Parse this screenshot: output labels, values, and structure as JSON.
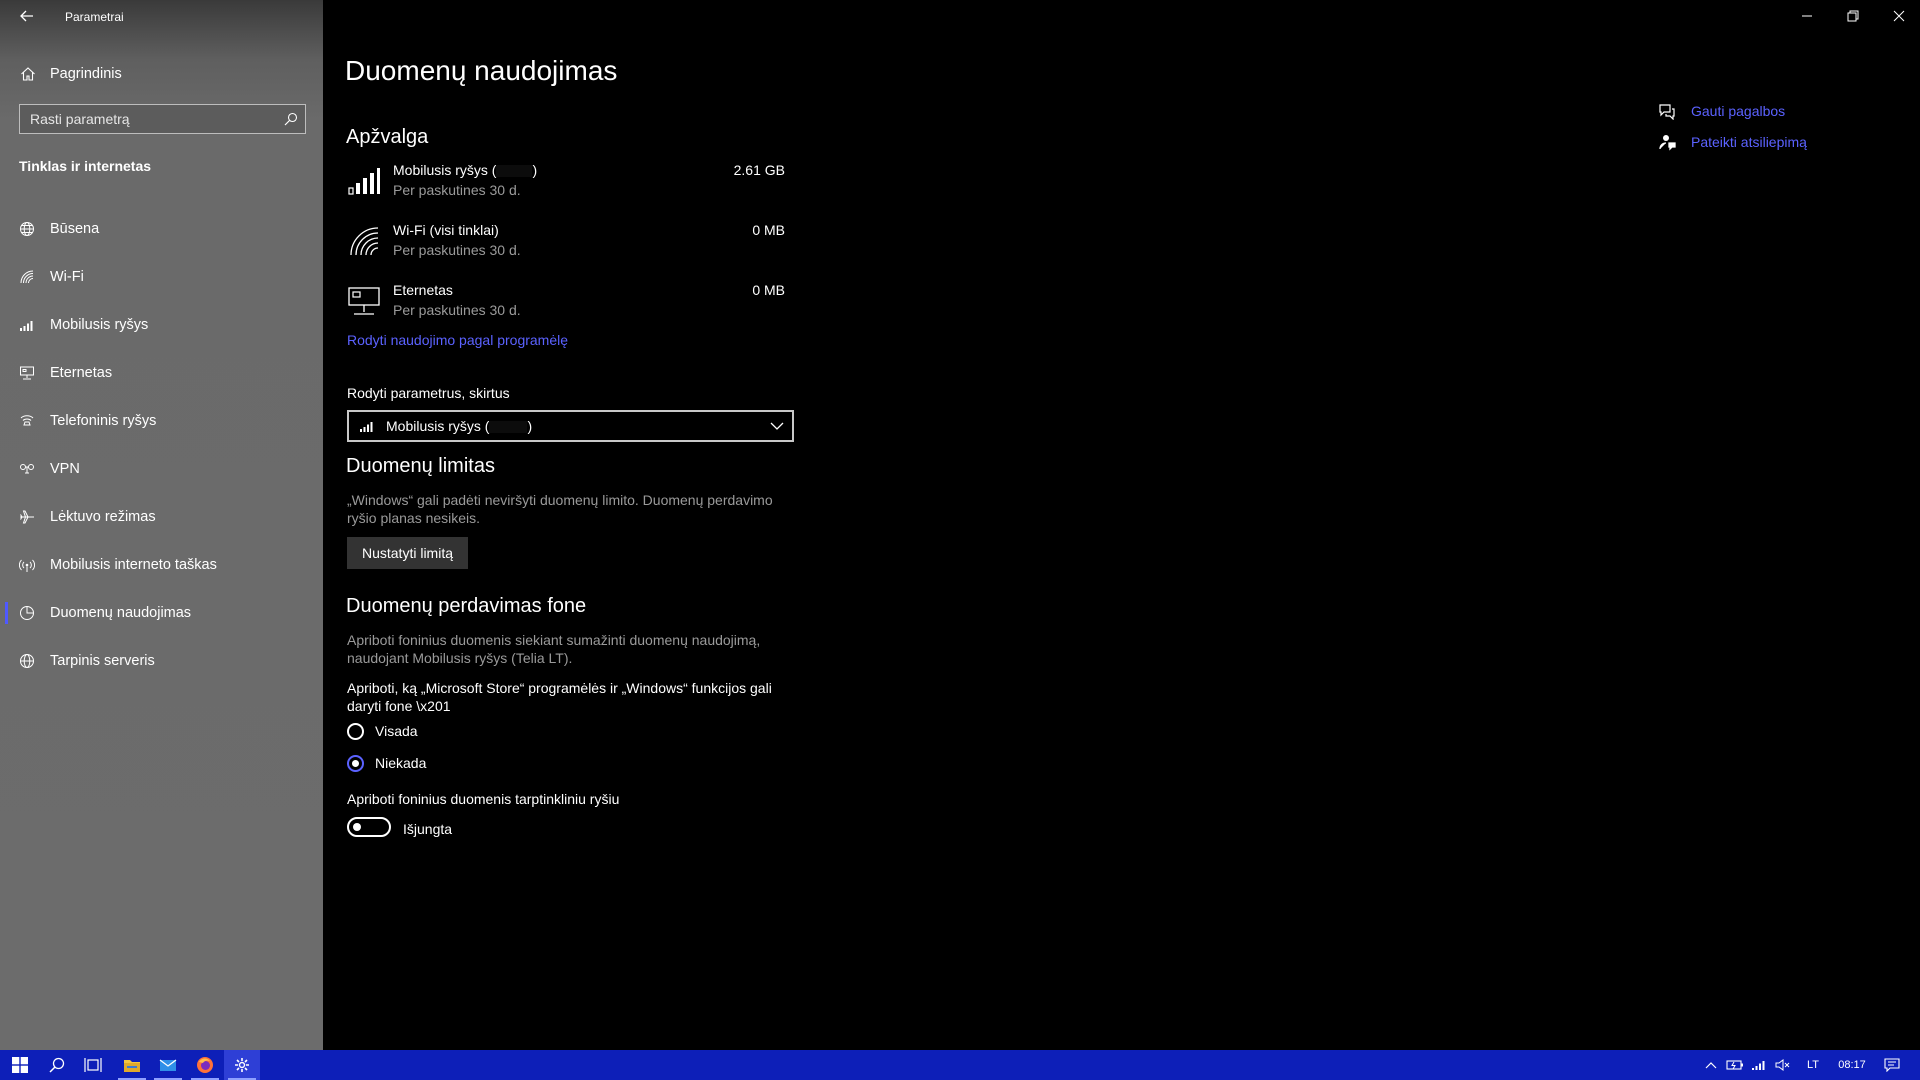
{
  "window": {
    "title": "Parametrai"
  },
  "sidebar": {
    "home_label": "Pagrindinis",
    "search_placeholder": "Rasti parametrą",
    "section_heading": "Tinklas ir internetas",
    "items": [
      {
        "label": "Būsena",
        "icon": "globe-icon"
      },
      {
        "label": "Wi-Fi",
        "icon": "wifi-icon"
      },
      {
        "label": "Mobilusis ryšys",
        "icon": "cellular-icon"
      },
      {
        "label": "Eternetas",
        "icon": "ethernet-icon"
      },
      {
        "label": "Telefoninis ryšys",
        "icon": "dialup-icon"
      },
      {
        "label": "VPN",
        "icon": "vpn-icon"
      },
      {
        "label": "Lėktuvo režimas",
        "icon": "airplane-icon"
      },
      {
        "label": "Mobilusis interneto taškas",
        "icon": "hotspot-icon"
      },
      {
        "label": "Duomenų naudojimas",
        "icon": "data-usage-icon",
        "active": true
      },
      {
        "label": "Tarpinis serveris",
        "icon": "proxy-icon"
      }
    ]
  },
  "main": {
    "title": "Duomenų naudojimas",
    "overview": {
      "heading": "Apžvalga",
      "rows": [
        {
          "name_prefix": "Mobilusis ryšys (",
          "name_suffix": ")",
          "period": "Per paskutines 30 d.",
          "amount": "2.61 GB"
        },
        {
          "name": "Wi-Fi (visi tinklai)",
          "period": "Per paskutines 30 d.",
          "amount": "0 MB"
        },
        {
          "name": "Eternetas",
          "period": "Per paskutines 30 d.",
          "amount": "0 MB"
        }
      ],
      "per_app_link": "Rodyti naudojimo pagal programėlę"
    },
    "show_settings_label": "Rodyti parametrus, skirtus",
    "dropdown": {
      "prefix": "Mobilusis ryšys (",
      "suffix": ")"
    },
    "data_limit": {
      "heading": "Duomenų limitas",
      "text_line1": "„Windows“ gali padėti neviršyti duomenų limito. Duomenų perdavimo",
      "text_line2": "ryšio planas nesikeis.",
      "button": "Nustatyti limitą"
    },
    "background": {
      "heading": "Duomenų perdavimas fone",
      "text_line1": "Apriboti foninius duomenis siekiant sumažinti duomenų naudojimą,",
      "text_line2": "naudojant Mobilusis ryšys (Telia LT).",
      "question_line1": "Apriboti, ką „Microsoft Store“ programėlės ir „Windows“ funkcijos gali",
      "question_line2": "daryti fone \\x201",
      "options": [
        {
          "label": "Visada",
          "checked": false
        },
        {
          "label": "Niekada",
          "checked": true
        }
      ],
      "roaming_label": "Apriboti foninius duomenis tarptinkliniu ryšiu",
      "toggle_state": "Išjungta"
    }
  },
  "help": {
    "get_help": "Gauti pagalbos",
    "feedback": "Pateikti atsiliepimą"
  },
  "taskbar": {
    "language": "LT",
    "time": "08:17"
  },
  "colors": {
    "accent": "#5b62ff",
    "taskbar": "#0d1fb8",
    "sidebar": "#6c6c6c",
    "background": "#000000"
  }
}
